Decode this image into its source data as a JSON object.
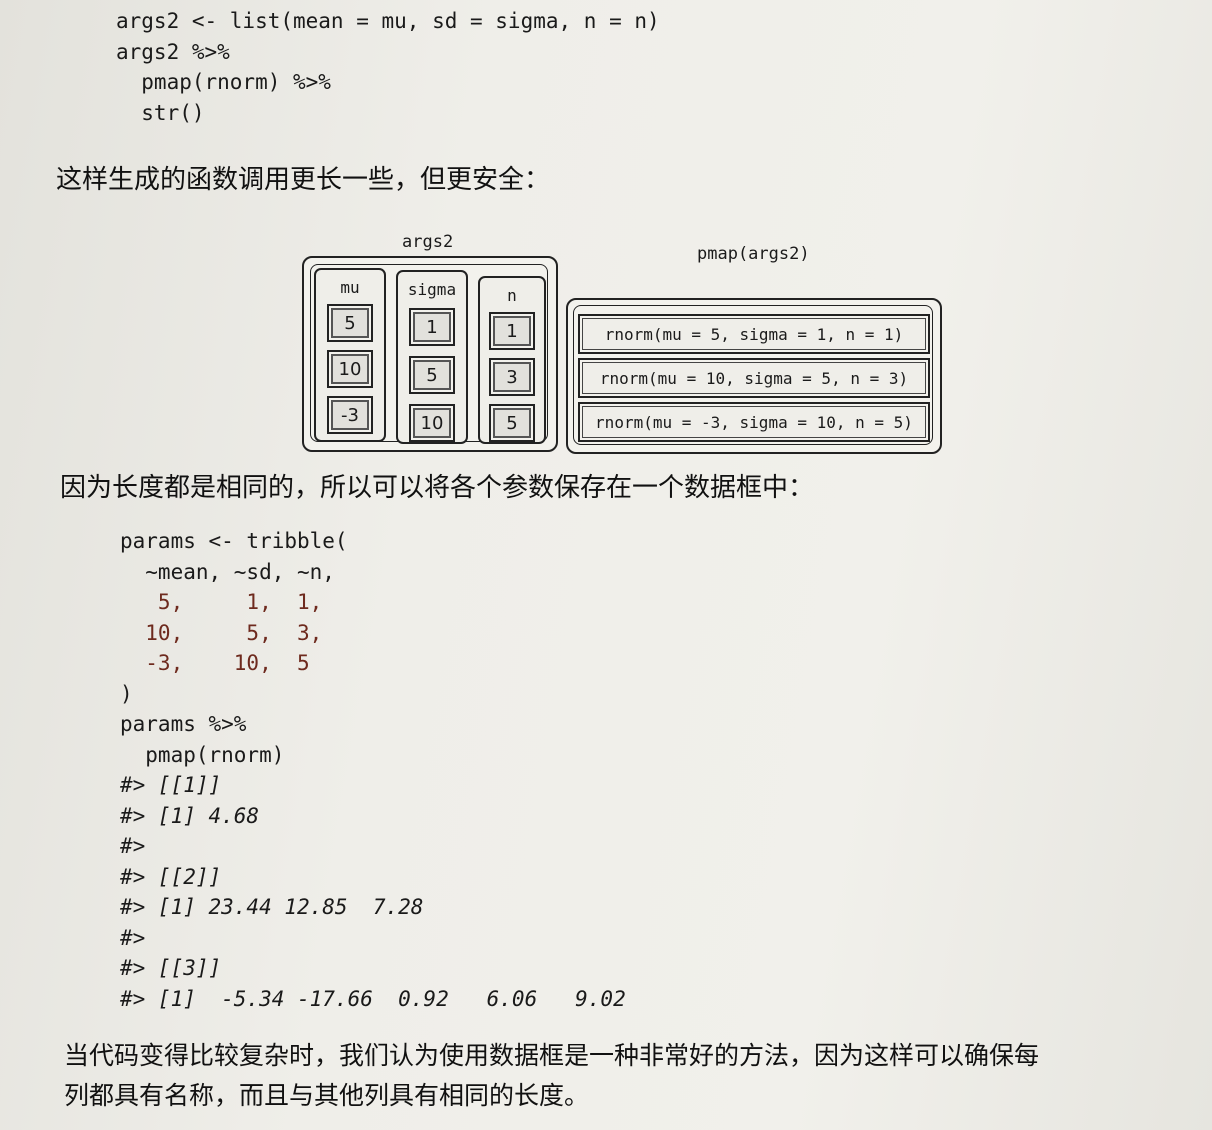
{
  "code_top": [
    "args2 <- list(mean = mu, sd = sigma, n = n)",
    "args2 %>%",
    "  pmap(rnorm) %>%",
    "  str()"
  ],
  "para1": "这样生成的函数调用更长一些，但更安全：",
  "diagram": {
    "left_label": "args2",
    "right_label": "pmap(args2)",
    "columns": [
      {
        "name": "mu",
        "values": [
          "5",
          "10",
          "-3"
        ]
      },
      {
        "name": "sigma",
        "values": [
          "1",
          "5",
          "10"
        ]
      },
      {
        "name": "n",
        "values": [
          "1",
          "3",
          "5"
        ]
      }
    ],
    "calls": [
      "rnorm(mu = 5, sigma = 1, n = 1)",
      "rnorm(mu = 10, sigma = 5, n = 3)",
      "rnorm(mu = -3, sigma = 10, n = 5)"
    ]
  },
  "para2": "因为长度都是相同的，所以可以将各个参数保存在一个数据框中：",
  "code_bottom": [
    "params <- tribble(",
    "  ~mean, ~sd, ~n,",
    "   5,     1,  1,",
    "  10,     5,  3,",
    "  -3,    10,  5",
    ")",
    "params %>%",
    "  pmap(rnorm)",
    "#> [[1]]",
    "#> [1] 4.68",
    "#>",
    "#> [[2]]",
    "#> [1] 23.44 12.85  7.28",
    "#>",
    "#> [[3]]",
    "#> [1]  -5.34 -17.66  0.92   6.06   9.02"
  ],
  "para3_line1": "当代码变得比较复杂时，我们认为使用数据框是一种非常好的方法，因为这样可以确保每",
  "para3_line2": "列都具有名称，而且与其他列具有相同的长度。"
}
